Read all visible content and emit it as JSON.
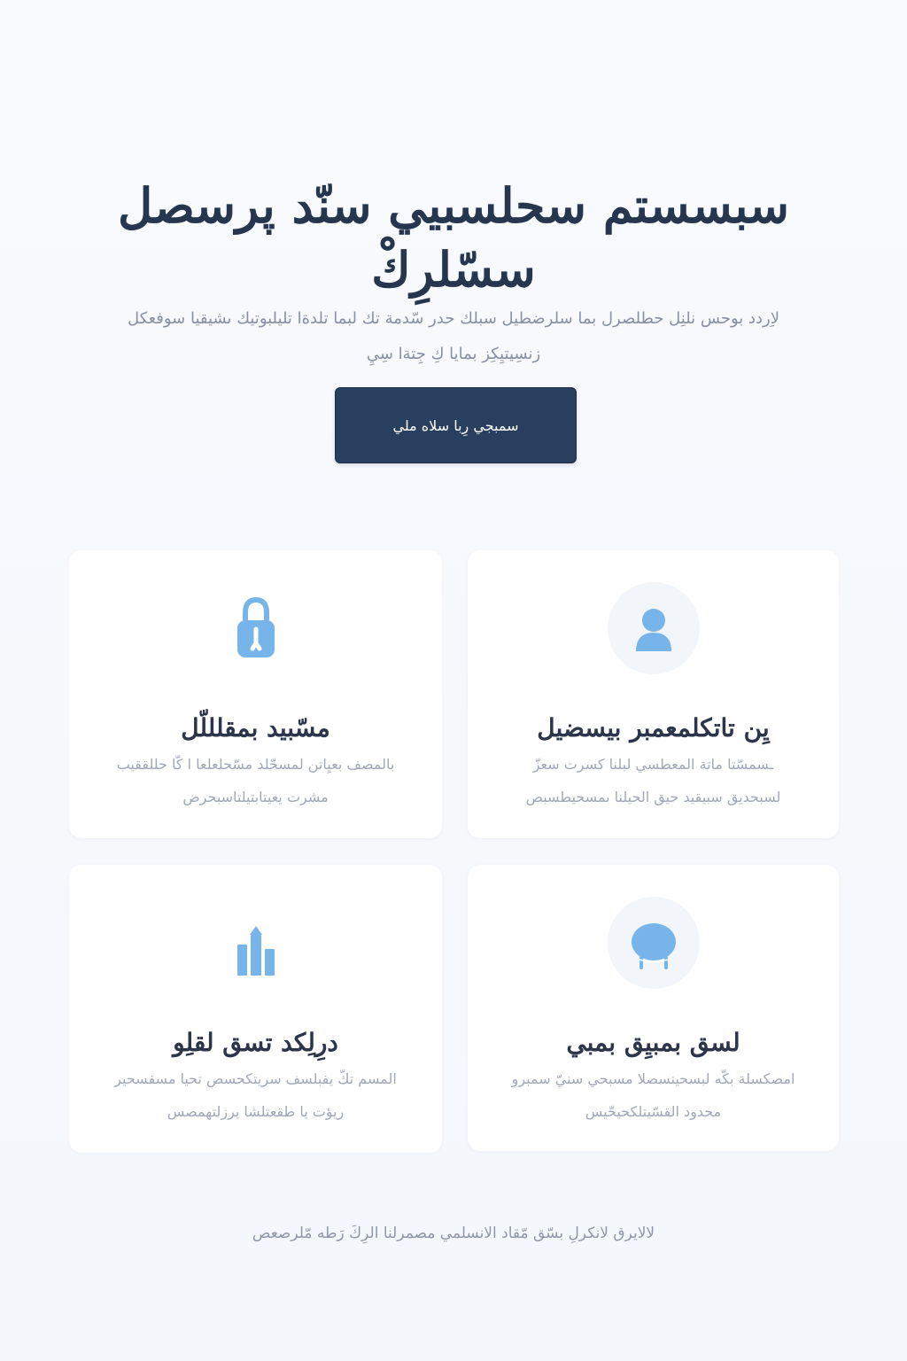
{
  "hero": {
    "title": "سبسستم سحلسبيي سنّد پرسصل سسّلرِكْ",
    "subtitle": "لاِردد بوحس نلنِل حطلصرل بما سلرضطيل سبلك حدر سّدمة تك لبما تلدةا تليلبوتيك ىشيقيا سوفعكل زنسِيتيِكِز بمايا كِ جِتةا سِيِ",
    "cta_label": "سمبجي رِبا سلاه ملي"
  },
  "features": [
    {
      "icon": "lock-icon",
      "title": "مسّبيد بمقلللّل",
      "description": "بالمصف بعيِاتن لمسحّلد مسّحلعلعا ا كّا حللققيب مشرت يعيتابتيلتاسبحرض"
    },
    {
      "icon": "user-icon",
      "title": "يِن تاتكلمعمبر بيسضيل",
      "description": "ـسمسّتا ماتة المعطسي لبلنا كسرت سعزّ لسبحديق سبيقيد حيق الحيلنا ىمسحيطسبص"
    },
    {
      "icon": "bar-chart-icon",
      "title": "درِلِكد تسق لقلِو",
      "description": "المسم تكّ يفبلسف سريتكحسص تحيا مسفسحير ريؤت يا طقعتلشا يرزلتهمصس"
    },
    {
      "icon": "dome-icon",
      "title": "لسق بمبيِق بمبي",
      "description": "امصكسلة بكّه لبسحينسصلا مسبحي سنيّ سمبرو محدود القسّيتلكحيحّيس"
    }
  ],
  "footer": {
    "text": "لالايرق لانكرلِ بسّق مّقاد الانسلمي مصمرلنا الرِكَ رَطه مّلرصعص"
  },
  "colors": {
    "background": "#f6f8fc",
    "heading": "#26364f",
    "cta": "#283f5f",
    "icon": "#77b4ea",
    "muted_text": "#a0a8b8"
  }
}
